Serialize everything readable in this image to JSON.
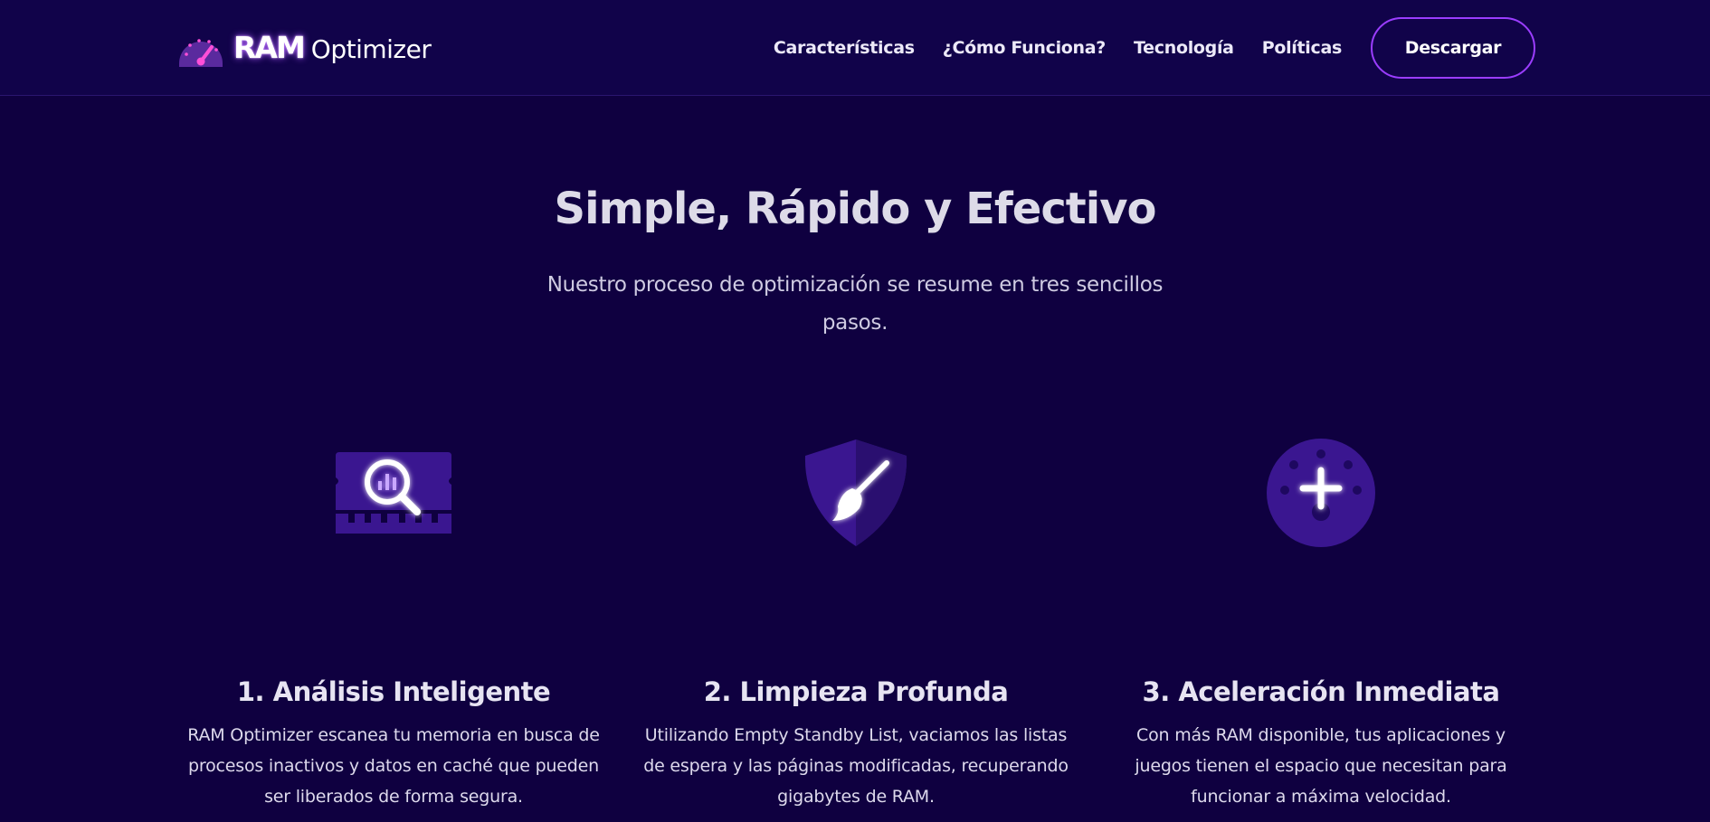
{
  "header": {
    "logo_icon": "speedometer-icon",
    "logo_ram": "RAM",
    "logo_optimizer": "Optimizer",
    "nav": [
      {
        "label": "Características"
      },
      {
        "label": "¿Cómo Funciona?"
      },
      {
        "label": "Tecnología"
      },
      {
        "label": "Políticas"
      }
    ],
    "cta_label": "Descargar"
  },
  "hero": {
    "title": "Simple, Rápido y Efectivo",
    "subtitle": "Nuestro proceso de optimización se resume en tres sencillos pasos."
  },
  "steps": [
    {
      "icon": "memory-analysis-icon",
      "title": "1. Análisis Inteligente",
      "body": "RAM Optimizer escanea tu memoria en busca de procesos inactivos y datos en caché que pueden ser liberados de forma segura."
    },
    {
      "icon": "shield-broom-icon",
      "title": "2. Limpieza Profunda",
      "body": "Utilizando Empty Standby List, vaciamos las listas de espera y las páginas modificadas, recuperando gigabytes de RAM."
    },
    {
      "icon": "gauge-plus-icon",
      "title": "3. Aceleración Inmediata",
      "body": "Con más RAM disponible, tus aplicaciones y juegos tienen el espacio que necesitan para funcionar a máxima velocidad."
    }
  ],
  "colors": {
    "background": "#0f0040",
    "header_bg": "#11034a",
    "accent": "#9b3dff",
    "icon_fill": "#3a1690"
  }
}
